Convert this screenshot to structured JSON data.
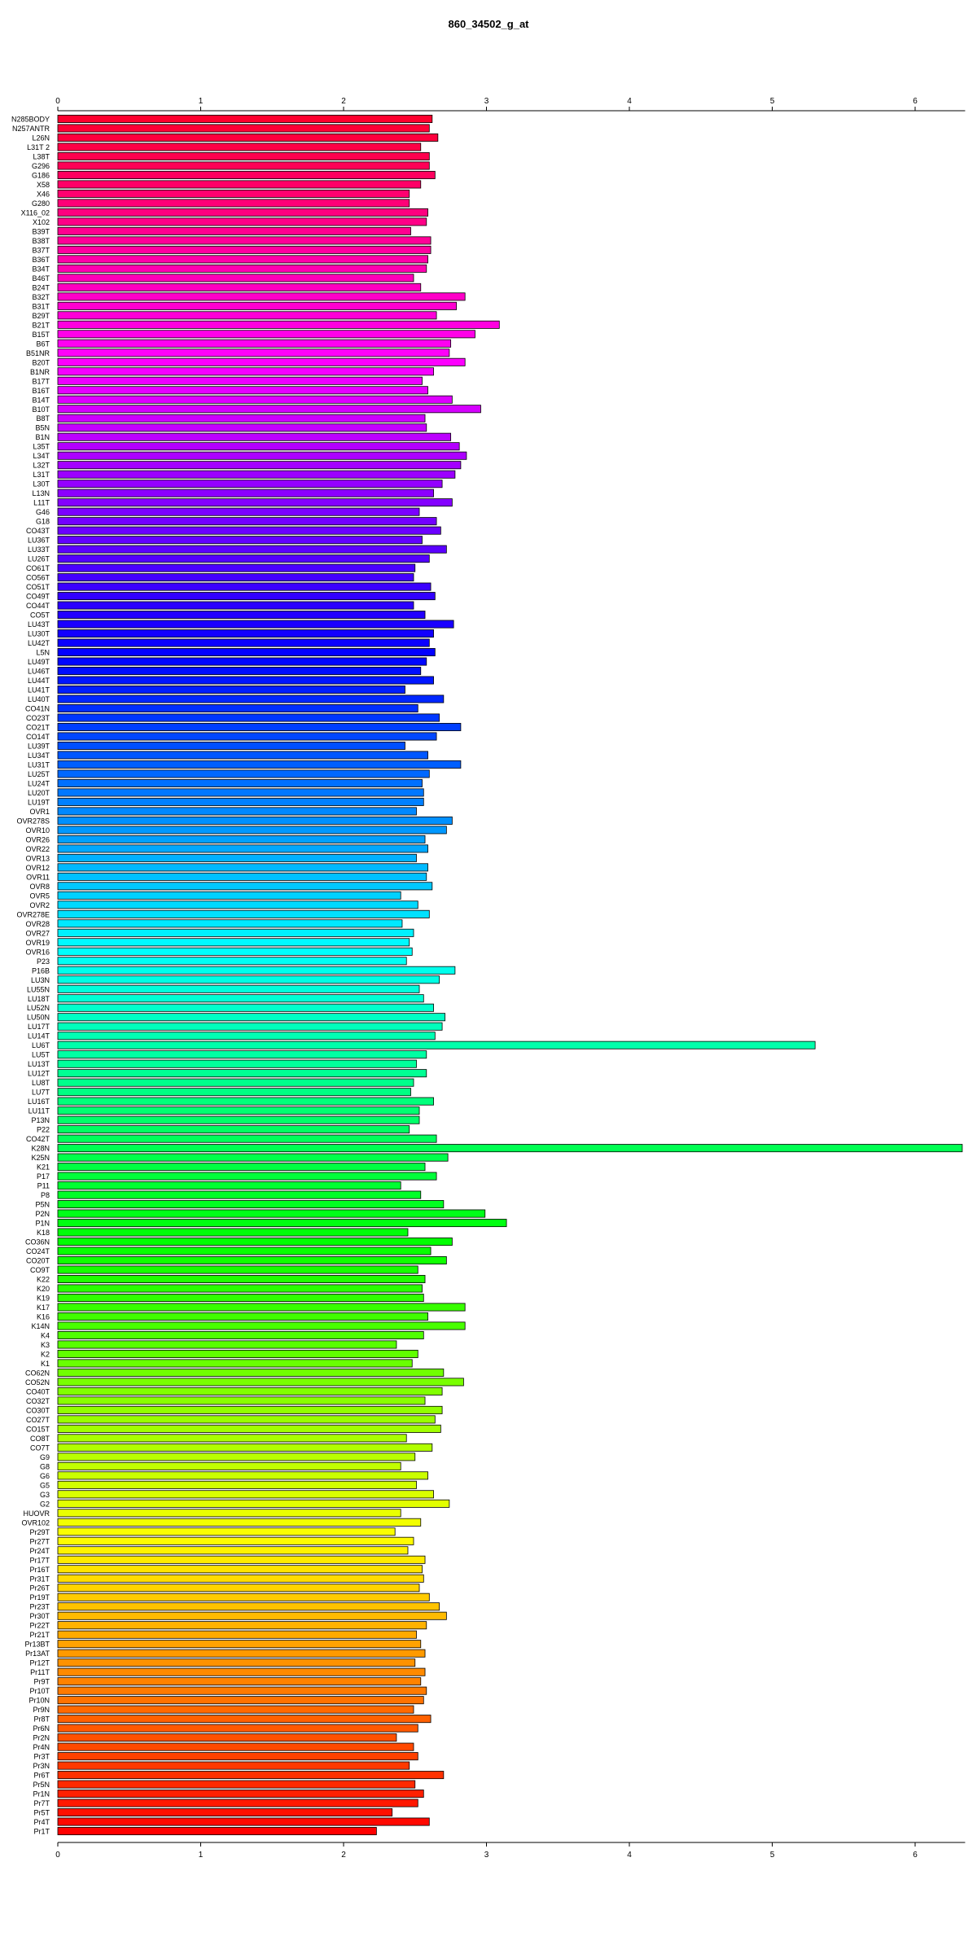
{
  "chart_data": {
    "type": "bar",
    "orientation": "horizontal",
    "title": "860_34502_g_at",
    "xlabel": "",
    "ylabel": "",
    "xlim": [
      0,
      6.35
    ],
    "x_ticks": [
      0,
      1,
      2,
      3,
      4,
      5,
      6
    ],
    "grid": false,
    "legend": "none",
    "color_scheme": "rainbow",
    "bar_border_color": "#000000",
    "categories": [
      "N285BODY",
      "N257ANTR",
      "L26N",
      "L31T 2",
      "L38T",
      "G296",
      "G186",
      "X58",
      "X46",
      "G280",
      "X116_02",
      "X102",
      "B39T",
      "B38T",
      "B37T",
      "B36T",
      "B34T",
      "B46T",
      "B24T",
      "B32T",
      "B31T",
      "B29T",
      "B21T",
      "B15T",
      "B6T",
      "B51NR",
      "B20T",
      "B1NR",
      "B17T",
      "B16T",
      "B14T",
      "B10T",
      "B8T",
      "B5N",
      "B1N",
      "L35T",
      "L34T",
      "L32T",
      "L31T",
      "L30T",
      "L13N",
      "L11T",
      "G46",
      "G18",
      "CO43T",
      "LU36T",
      "LU33T",
      "LU26T",
      "CO61T",
      "CO56T",
      "CO51T",
      "CO49T",
      "CO44T",
      "CO5T",
      "LU43T",
      "LU30T",
      "LU42T",
      "L5N",
      "LU49T",
      "LU46T",
      "LU44T",
      "LU41T",
      "LU40T",
      "CO41N",
      "CO23T",
      "CO21T",
      "CO14T",
      "LU39T",
      "LU34T",
      "LU31T",
      "LU25T",
      "LU24T",
      "LU20T",
      "LU19T",
      "OVR1",
      "OVR278S",
      "OVR10",
      "OVR26",
      "OVR22",
      "OVR13",
      "OVR12",
      "OVR11",
      "OVR8",
      "OVR5",
      "OVR2",
      "OVR278E",
      "OVR28",
      "OVR27",
      "OVR19",
      "OVR16",
      "P23",
      "P16B",
      "LU3N",
      "LU55N",
      "LU18T",
      "LU52N",
      "LU50N",
      "LU17T",
      "LU14T",
      "LU6T",
      "LU5T",
      "LU13T",
      "LU12T",
      "LU8T",
      "LU7T",
      "LU16T",
      "LU11T",
      "P13N",
      "P22",
      "CO42T",
      "K28N",
      "K25N",
      "K21",
      "P17",
      "P11",
      "P8",
      "P5N",
      "P2N",
      "P1N",
      "K18",
      "CO36N",
      "CO24T",
      "CO20T",
      "CO9T",
      "K22",
      "K20",
      "K19",
      "K17",
      "K16",
      "K14N",
      "K4",
      "K3",
      "K2",
      "K1",
      "CO62N",
      "CO52N",
      "CO40T",
      "CO32T",
      "CO30T",
      "CO27T",
      "CO15T",
      "CO8T",
      "CO7T",
      "G9",
      "G8",
      "G6",
      "G5",
      "G3",
      "G2",
      "HUOVR",
      "OVR102",
      "Pr29T",
      "Pr27T",
      "Pr24T",
      "Pr17T",
      "Pr16T",
      "Pr31T",
      "Pr26T",
      "Pr19T",
      "Pr23T",
      "Pr30T",
      "Pr22T",
      "Pr21T",
      "Pr13BT",
      "Pr13AT",
      "Pr12T",
      "Pr11T",
      "Pr9T",
      "Pr10T",
      "Pr10N",
      "Pr9N",
      "Pr8T",
      "Pr6N",
      "Pr2N",
      "Pr4N",
      "Pr3T",
      "Pr3N",
      "Pr6T",
      "Pr5N",
      "Pr1N",
      "Pr7T",
      "Pr5T",
      "Pr4T",
      "Pr1T"
    ],
    "values": [
      2.62,
      2.6,
      2.66,
      2.54,
      2.6,
      2.6,
      2.64,
      2.54,
      2.46,
      2.46,
      2.59,
      2.58,
      2.47,
      2.61,
      2.61,
      2.59,
      2.58,
      2.49,
      2.54,
      2.85,
      2.79,
      2.65,
      3.09,
      2.92,
      2.75,
      2.74,
      2.85,
      2.63,
      2.55,
      2.59,
      2.76,
      2.96,
      2.57,
      2.58,
      2.75,
      2.81,
      2.86,
      2.82,
      2.78,
      2.69,
      2.63,
      2.76,
      2.53,
      2.65,
      2.68,
      2.55,
      2.72,
      2.6,
      2.5,
      2.49,
      2.61,
      2.64,
      2.49,
      2.57,
      2.77,
      2.63,
      2.6,
      2.64,
      2.58,
      2.54,
      2.63,
      2.43,
      2.7,
      2.52,
      2.67,
      2.82,
      2.65,
      2.43,
      2.59,
      2.82,
      2.6,
      2.55,
      2.56,
      2.56,
      2.51,
      2.76,
      2.72,
      2.57,
      2.59,
      2.51,
      2.59,
      2.58,
      2.62,
      2.4,
      2.52,
      2.6,
      2.41,
      2.49,
      2.46,
      2.48,
      2.44,
      2.78,
      2.67,
      2.53,
      2.56,
      2.63,
      2.71,
      2.69,
      2.64,
      5.3,
      2.58,
      2.51,
      2.58,
      2.49,
      2.47,
      2.63,
      2.53,
      2.53,
      2.46,
      2.65,
      6.33,
      2.73,
      2.57,
      2.65,
      2.4,
      2.54,
      2.7,
      2.99,
      3.14,
      2.45,
      2.76,
      2.61,
      2.72,
      2.52,
      2.57,
      2.55,
      2.56,
      2.85,
      2.59,
      2.85,
      2.56,
      2.37,
      2.52,
      2.48,
      2.7,
      2.84,
      2.69,
      2.57,
      2.69,
      2.64,
      2.68,
      2.44,
      2.62,
      2.5,
      2.4,
      2.59,
      2.51,
      2.63,
      2.74,
      2.4,
      2.54,
      2.36,
      2.49,
      2.45,
      2.57,
      2.55,
      2.56,
      2.53,
      2.6,
      2.67,
      2.72,
      2.58,
      2.51,
      2.54,
      2.57,
      2.5,
      2.57,
      2.54,
      2.58,
      2.56,
      2.49,
      2.61,
      2.52,
      2.37,
      2.49,
      2.52,
      2.46,
      2.7,
      2.5,
      2.56,
      2.52,
      2.34,
      2.6,
      2.23
    ]
  }
}
